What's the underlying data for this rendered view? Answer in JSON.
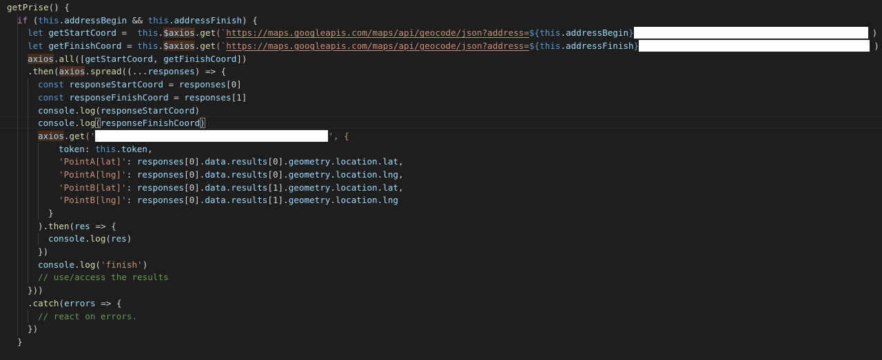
{
  "editor": {
    "theme": "dark",
    "background": "#1e1e1e"
  },
  "code": {
    "l1": {
      "fn_name": "getPrise",
      "rest": "() {"
    },
    "l2": {
      "kw_if": "if",
      "open": " (",
      "this1": "this",
      "prop1": ".addressBegin",
      "and": " && ",
      "this2": "this",
      "prop2": ".addressFinish",
      "close": ") {"
    },
    "l3": {
      "kw_let": "let",
      "var": " getStartCoord",
      "eq": " =  ",
      "this": "this",
      "dot": ".",
      "axios": "$axios",
      "dot2": ".",
      "get": "get",
      "paren": "(`",
      "url": "https://maps.googleapis.com/maps/api/geocode/json?address=",
      "tpl_open": "${",
      "tthis": "this",
      "tprop": ".addressBegin",
      "tpl_close": "}",
      "end": ")"
    },
    "l4": {
      "kw_let": "let",
      "var": " getFinishCoord",
      "eq": " = ",
      "this": "this",
      "dot": ".",
      "axios": "$axios",
      "dot2": ".",
      "get": "get",
      "paren": "(`",
      "url": "https://maps.googleapis.com/maps/api/geocode/json?address=",
      "tpl_open": "${",
      "tthis": "this",
      "tprop": ".addressFinish",
      "tpl_close": "}",
      "end": ")"
    },
    "l5": {
      "axios": "axios",
      "dot": ".",
      "all": "all",
      "args_open": "([",
      "a1": "getStartCoord",
      "comma": ", ",
      "a2": "getFinishCoord",
      "args_close": "])"
    },
    "l6": {
      "dot": ".",
      "then": "then",
      "open": "(",
      "axios": "axios",
      "dot2": ".",
      "spread": "spread",
      "rest": "((",
      "spreadop": "...",
      "responses": "responses",
      "arrow": ") => {"
    },
    "l7": {
      "kw": "const",
      "var": " responseStartCoord",
      "eq": " = ",
      "val": "responses",
      "idx": "[0]"
    },
    "l8": {
      "kw": "const",
      "var": " responseFinishCoord",
      "eq": " = ",
      "val": "responses",
      "idx": "[1]"
    },
    "l9": {
      "obj": "console",
      "dot": ".",
      "fn": "log",
      "open": "(",
      "arg": "responseStartCoord",
      "close": ")"
    },
    "l10": {
      "obj": "console",
      "dot": ".",
      "fn": "log",
      "open": "(",
      "arg": "responseFinishCoord",
      "close": ")"
    },
    "l11": {
      "axios": "axios",
      "dot": ".",
      "get": "get",
      "open": "('",
      "close": "', {"
    },
    "l12": {
      "key": "token",
      "colon": ": ",
      "this": "this",
      "prop": ".token",
      "comma": ","
    },
    "l13": {
      "key": "'PointA[lat]'",
      "colon": ": ",
      "val": "responses",
      "rest": "[0].",
      "p1": "data",
      "p2": "results",
      "idx": "[0].",
      "p3": "geometry",
      "p4": "location",
      "p5": "lat",
      "comma": ","
    },
    "l14": {
      "key": "'PointA[lng]'",
      "colon": ": ",
      "val": "responses",
      "rest": "[0].",
      "p1": "data",
      "p2": "results",
      "idx": "[0].",
      "p3": "geometry",
      "p4": "location",
      "p5": "lng",
      "comma": ","
    },
    "l15": {
      "key": "'PointB[lat]'",
      "colon": ": ",
      "val": "responses",
      "rest": "[0].",
      "p1": "data",
      "p2": "results",
      "idx": "[1].",
      "p3": "geometry",
      "p4": "location",
      "p5": "lat",
      "comma": ","
    },
    "l16": {
      "key": "'PointB[lng]'",
      "colon": ": ",
      "val": "responses",
      "rest": "[0].",
      "p1": "data",
      "p2": "results",
      "idx": "[1].",
      "p3": "geometry",
      "p4": "location",
      "p5": "lng"
    },
    "l17": {
      "text": "}"
    },
    "l18": {
      "open": ").",
      "then": "then",
      "rest": "(",
      "res": "res",
      "arrow": " => {"
    },
    "l19": {
      "obj": "console",
      "dot": ".",
      "fn": "log",
      "open": "(",
      "arg": "res",
      "close": ")"
    },
    "l20": {
      "text": "})"
    },
    "l21": {
      "obj": "console",
      "dot": ".",
      "fn": "log",
      "open": "(",
      "str": "'finish'",
      "close": ")"
    },
    "l22": {
      "comment": "// use/access the results"
    },
    "l23": {
      "text": "}))"
    },
    "l24": {
      "dot": ".",
      "catch": "catch",
      "open": "(",
      "errors": "errors",
      "arrow": " => {"
    },
    "l25": {
      "comment": "// react on errors."
    },
    "l26": {
      "text": "})"
    },
    "l27": {
      "text": "}"
    }
  }
}
